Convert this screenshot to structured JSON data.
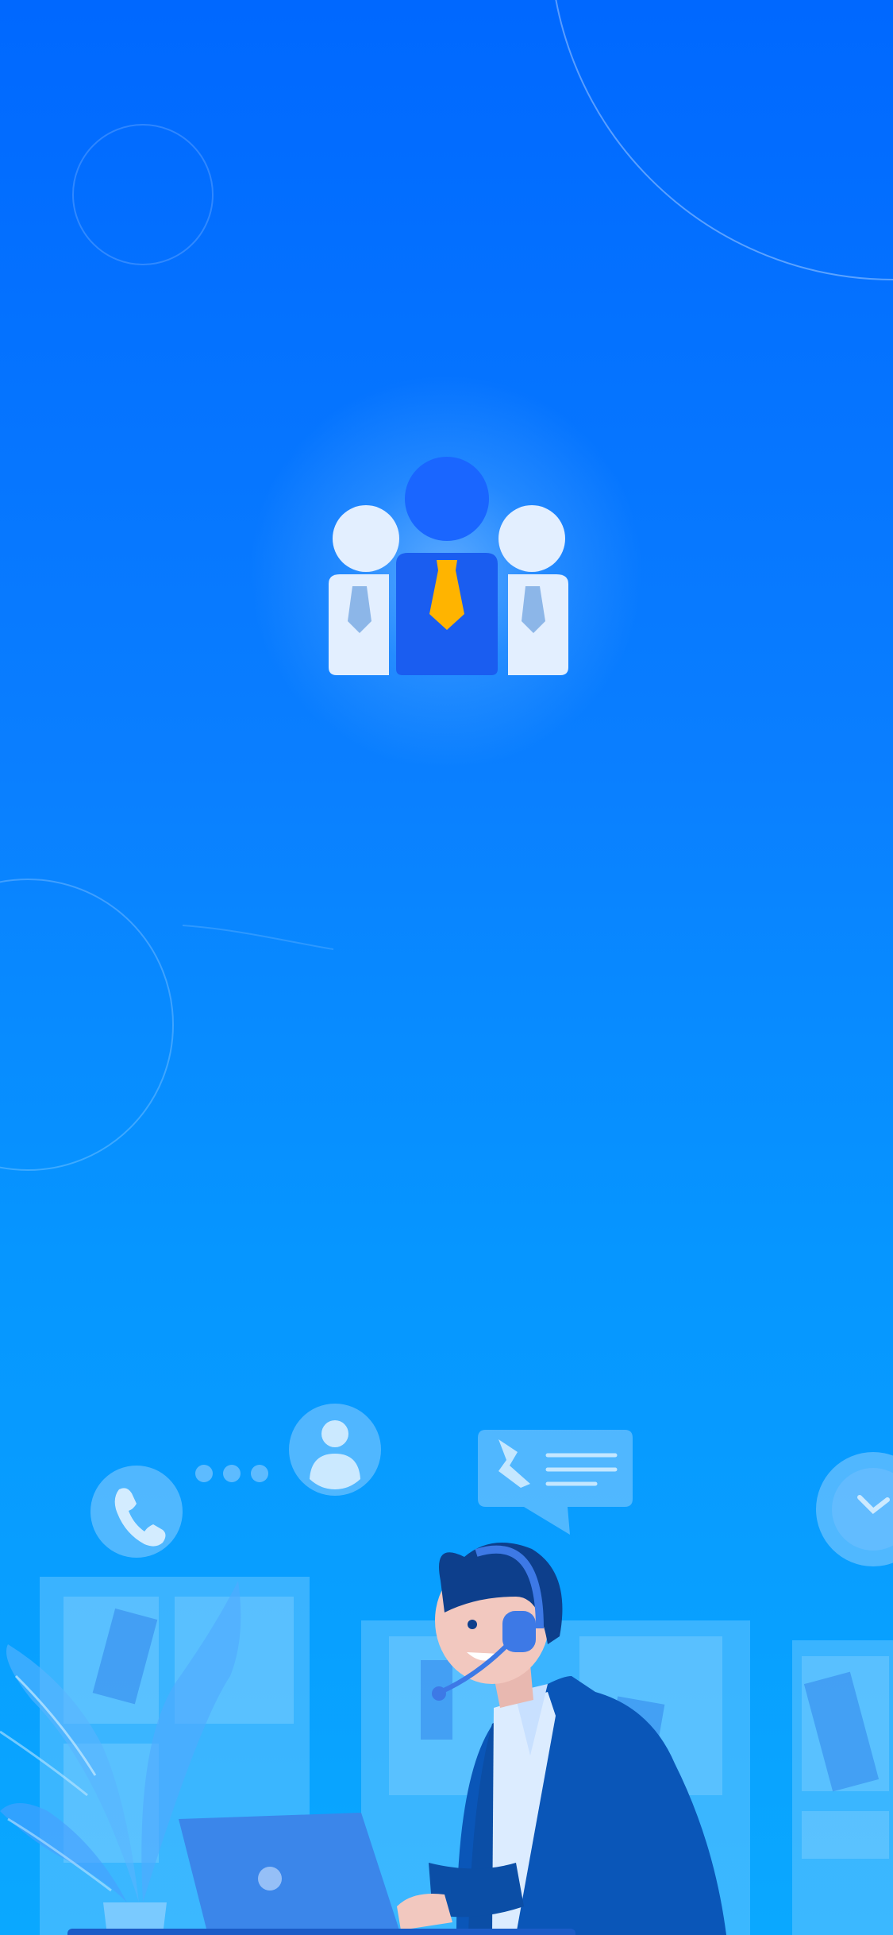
{
  "screen": {
    "type": "splash",
    "background_top": "#0068ff",
    "background_bottom": "#0aa8ff"
  },
  "logo": {
    "icon": "team-users-icon",
    "primary_color": "#1a66ff",
    "tie_color": "#ffb400",
    "secondary_color": "#e3efff"
  },
  "illustration": {
    "subject": "customer-service-agent",
    "icons": [
      "phone-icon",
      "ellipsis-icon",
      "user-avatar-icon",
      "chat-bubble-icon",
      "clock-icon",
      "headset-icon",
      "laptop-icon",
      "plant-icon"
    ]
  }
}
